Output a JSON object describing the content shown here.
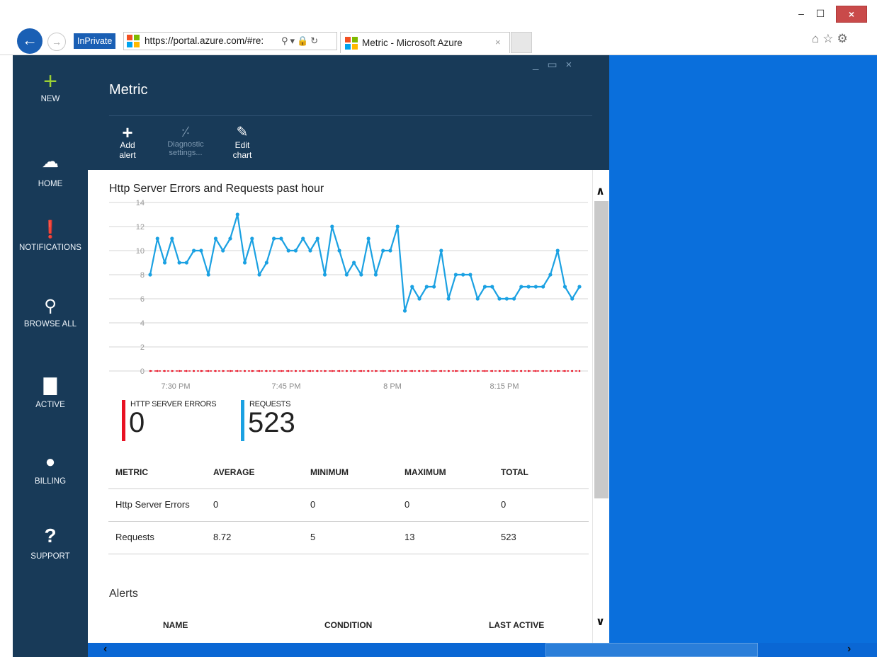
{
  "window": {
    "min_icon": "minimize-icon",
    "max_icon": "maximize-icon",
    "close_icon": "close-icon"
  },
  "browser": {
    "inprivate_label": "InPrivate",
    "address": "https://portal.azure.com/#re:",
    "tab_title": "Metric - Microsoft Azure",
    "tab_close": "×"
  },
  "nav": {
    "items": [
      {
        "label": "NEW",
        "icon": "plus-icon"
      },
      {
        "label": "HOME",
        "icon": "cloud-icon"
      },
      {
        "label": "NOTIFICATIONS",
        "icon": "alert-icon"
      },
      {
        "label": "BROWSE ALL",
        "icon": "browse-icon"
      },
      {
        "label": "ACTIVE",
        "icon": "window-icon"
      },
      {
        "label": "BILLING",
        "icon": "billing-icon"
      },
      {
        "label": "SUPPORT",
        "icon": "question-icon"
      }
    ]
  },
  "blade": {
    "title": "Metric",
    "commands": [
      {
        "label": "Add alert",
        "icon": "plus-icon",
        "enabled": true
      },
      {
        "label": "Diagnostic settings...",
        "icon": "wrench-icon",
        "enabled": false
      },
      {
        "label": "Edit chart",
        "icon": "pencil-icon",
        "enabled": true
      }
    ]
  },
  "chart_data": {
    "type": "line",
    "title": "Http Server Errors and Requests past hour",
    "ylim": [
      0,
      14
    ],
    "y_ticks": [
      "0",
      "2",
      "4",
      "6",
      "8",
      "10",
      "12",
      "14"
    ],
    "x_tick_labels": [
      "7:30 PM",
      "7:45 PM",
      "8 PM",
      "8:15 PM"
    ],
    "grid": true,
    "series": [
      {
        "name": "REQUESTS",
        "color": "#1ba1e2",
        "values": [
          8,
          11,
          9,
          11,
          9,
          9,
          10,
          10,
          8,
          11,
          10,
          11,
          13,
          9,
          11,
          8,
          9,
          11,
          11,
          10,
          10,
          11,
          10,
          11,
          8,
          12,
          10,
          8,
          9,
          8,
          11,
          8,
          10,
          10,
          12,
          5,
          7,
          6,
          7,
          7,
          10,
          6,
          8,
          8,
          8,
          6,
          7,
          7,
          6,
          6,
          6,
          7,
          7,
          7,
          7,
          8,
          10,
          7,
          6,
          7
        ]
      },
      {
        "name": "HTTP SERVER ERRORS",
        "color": "#e81123",
        "values": [
          0,
          0,
          0,
          0,
          0,
          0,
          0,
          0,
          0,
          0,
          0,
          0,
          0,
          0,
          0,
          0,
          0,
          0,
          0,
          0,
          0,
          0,
          0,
          0,
          0,
          0,
          0,
          0,
          0,
          0,
          0,
          0,
          0,
          0,
          0,
          0,
          0,
          0,
          0,
          0,
          0,
          0,
          0,
          0,
          0,
          0,
          0,
          0,
          0,
          0,
          0,
          0,
          0,
          0,
          0,
          0,
          0,
          0,
          0,
          0
        ]
      }
    ]
  },
  "summary": {
    "errors": {
      "label": "HTTP SERVER ERRORS",
      "value": "0",
      "color": "#e81123"
    },
    "requests": {
      "label": "REQUESTS",
      "value": "523",
      "color": "#1ba1e2"
    }
  },
  "table": {
    "headers": [
      "METRIC",
      "AVERAGE",
      "MINIMUM",
      "MAXIMUM",
      "TOTAL"
    ],
    "rows": [
      [
        "Http Server Errors",
        "0",
        "0",
        "0",
        "0"
      ],
      [
        "Requests",
        "8.72",
        "5",
        "13",
        "523"
      ]
    ]
  },
  "alerts": {
    "title": "Alerts",
    "headers": [
      "NAME",
      "CONDITION",
      "LAST ACTIVE"
    ]
  }
}
